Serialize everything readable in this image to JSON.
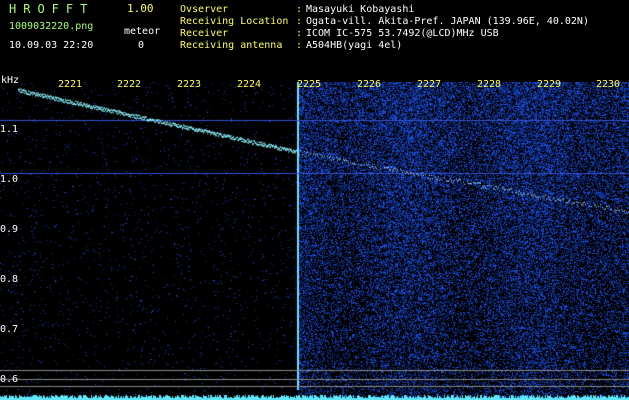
{
  "app": {
    "title": "HROFFT",
    "version": "1.00"
  },
  "file": {
    "name": "1009032220.png",
    "datetime": "10.09.03 22:20"
  },
  "meteor": {
    "label": "meteor",
    "count": "0"
  },
  "info": [
    {
      "label": "Ovserver",
      "value": "Masayuki Kobayashi"
    },
    {
      "label": "Receiving Location",
      "value": "Ogata-vill. Akita-Pref. JAPAN (139.96E, 40.02N)"
    },
    {
      "label": "Receiver",
      "value": "ICOM IC-575 53.7492(@LCD)MHz USB"
    },
    {
      "label": "Receiving antenna",
      "value": "A504HB(yagi 4el)"
    }
  ],
  "separator": ":",
  "axis": {
    "y_unit": "kHz",
    "y_labels": [
      "1.1",
      "1.0",
      "0.9",
      "0.8",
      "0.7",
      "0.6"
    ],
    "x_labels": [
      "2221",
      "2222",
      "2223",
      "2224",
      "2225",
      "2226",
      "2227",
      "2228",
      "2229",
      "2230"
    ]
  },
  "colors": {
    "text_green": "#a8ff6a",
    "text_yellow": "#ffff55",
    "spectrum": "#2a5cff",
    "trace": "#8ff7ff"
  }
}
